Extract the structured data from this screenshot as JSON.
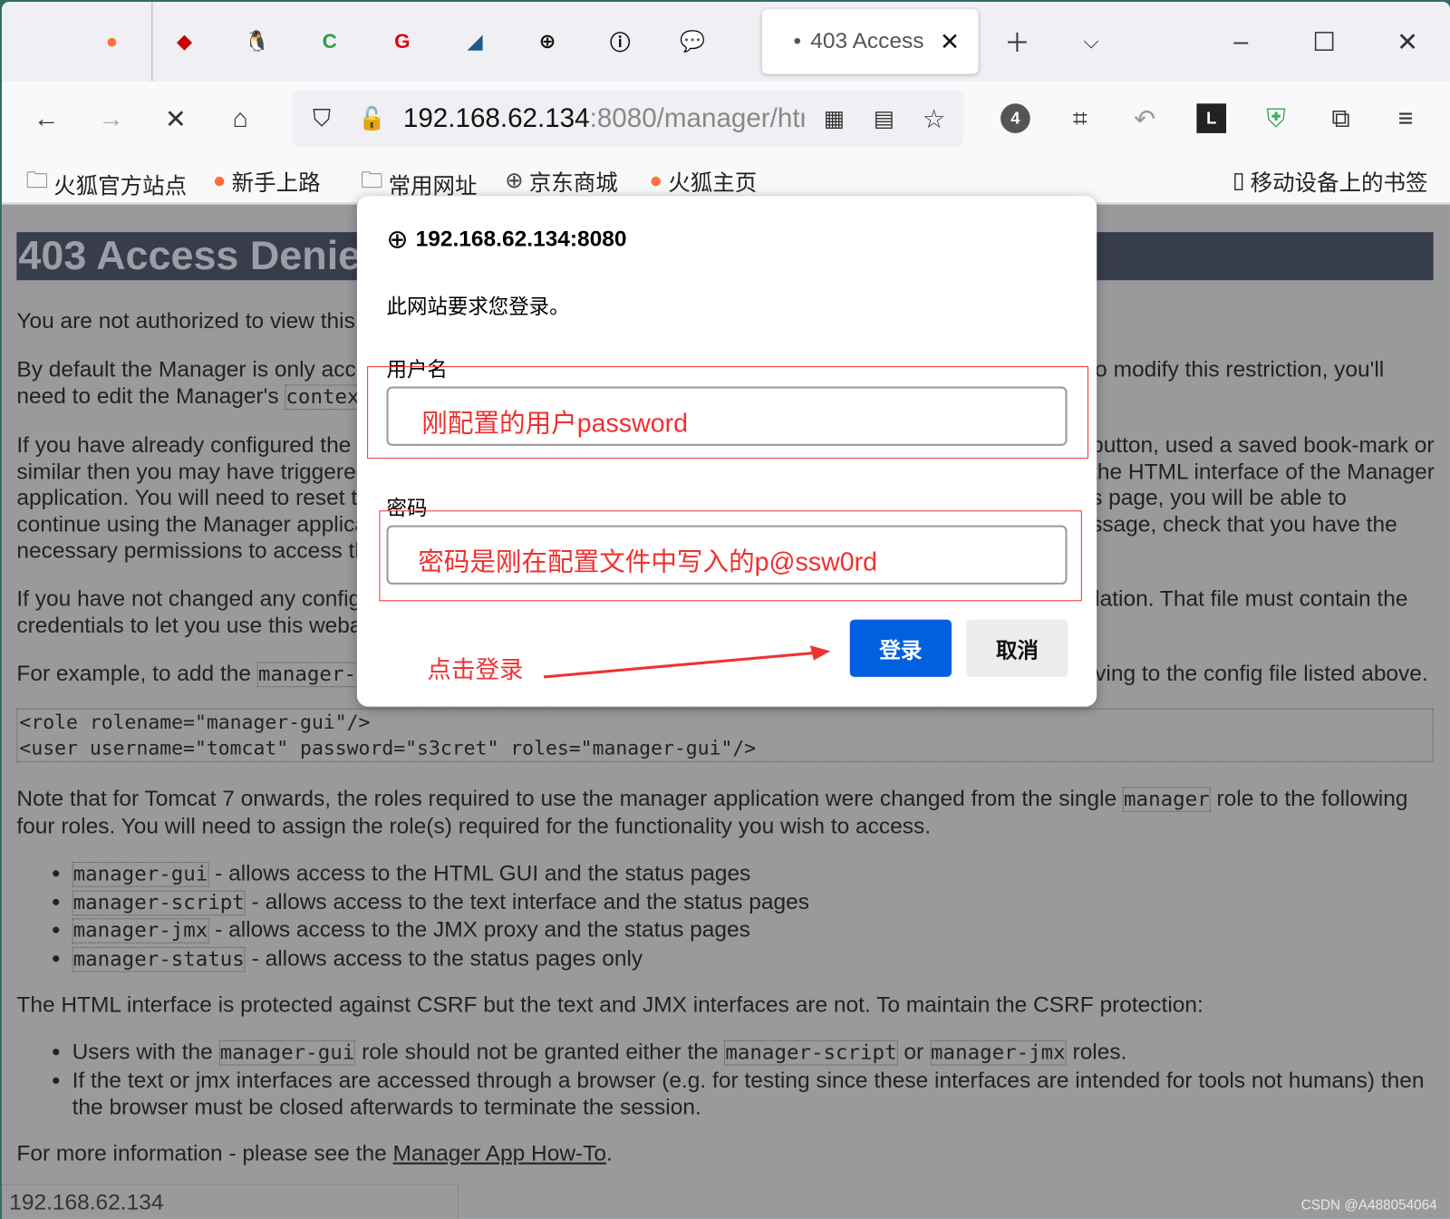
{
  "browser": {
    "pinned_tabs": [
      {
        "icon": "firefox-icon",
        "glyph": "●",
        "color": "#ff7139"
      },
      {
        "icon": "redhat-icon",
        "glyph": "◆",
        "color": "#cc0000"
      },
      {
        "icon": "linux-penguin-icon",
        "glyph": "🐧",
        "color": "#333333"
      },
      {
        "icon": "c-logo-icon",
        "glyph": "C",
        "color": "#2e9e4a"
      },
      {
        "icon": "g-logo-icon",
        "glyph": "G",
        "color": "#e00012"
      },
      {
        "icon": "mysql-icon",
        "glyph": "◢",
        "color": "#1d5a8a"
      },
      {
        "icon": "globe-icon",
        "glyph": "⊕",
        "color": "#111111"
      },
      {
        "icon": "info-icon",
        "glyph": "ⓘ",
        "color": "#111111"
      },
      {
        "icon": "chat-icon",
        "glyph": "💬",
        "color": "#1677ff"
      }
    ],
    "active_tab": {
      "title": "403 Access",
      "dot": "•"
    },
    "url_host": "192.168.62.134",
    "url_rest": ":8080/manager/htr",
    "toolbar_badge": "4",
    "bookmarks": [
      {
        "icon": "folder-icon",
        "label": "火狐官方站点"
      },
      {
        "icon": "firefox-icon",
        "label": "新手上路"
      },
      {
        "icon": "folder-icon",
        "label": "常用网址"
      },
      {
        "icon": "globe-icon",
        "label": "京东商城"
      },
      {
        "icon": "firefox-icon",
        "label": "火狐主页"
      }
    ],
    "mobile_bookmarks": "移动设备上的书签"
  },
  "page": {
    "title": "403 Access Denie",
    "p1": "You are not authorized to view this",
    "p2a": "By default the Manager is only acce",
    "p2a_r": "o modify this restriction, you'll",
    "p2b": "need to edit the Manager's ",
    "p2b_code": "contex",
    "p3": [
      "If you have already configured the",
      "similar then you may have triggerec",
      "application. You will need to reset t",
      "continue using the Manager applica",
      "necessary permissions to access thi"
    ],
    "p3_r": [
      "button, used a saved book-mark or",
      "the HTML interface of the Manager",
      "s page, you will be able to",
      "ssage, check that you have the",
      ""
    ],
    "p4": [
      "If you have not changed any config",
      "credentials to let you use this weba"
    ],
    "p4_r": "lation. That file must contain the",
    "p5": "For example, to add the ",
    "p5_code": "manager-g",
    "p5_r": "ving to the config file listed above.",
    "pre": "<role rolename=\"manager-gui\"/>\n<user username=\"tomcat\" password=\"s3cret\" roles=\"manager-gui\"/>",
    "p6a": "Note that for Tomcat 7 onwards, the roles required to use the manager application were changed from the single ",
    "p6_code": "manager",
    "p6b": " role to the following",
    "p6c": "four roles. You will need to assign the role(s) required for the functionality you wish to access.",
    "roles": [
      {
        "code": "manager-gui",
        "text": " - allows access to the HTML GUI and the status pages"
      },
      {
        "code": "manager-script",
        "text": " - allows access to the text interface and the status pages"
      },
      {
        "code": "manager-jmx",
        "text": " - allows access to the JMX proxy and the status pages"
      },
      {
        "code": "manager-status",
        "text": " - allows access to the status pages only"
      }
    ],
    "p7": "The HTML interface is protected against CSRF but the text and JMX interfaces are not. To maintain the CSRF protection:",
    "csrf1": {
      "a": "Users with the ",
      "c1": "manager-gui",
      "b": " role should not be granted either the ",
      "c2": "manager-script",
      "c": " or ",
      "c3": "manager-jmx",
      "d": " roles."
    },
    "csrf2": [
      "If the text or jmx interfaces are accessed through a browser (e.g. for testing since these interfaces are intended for tools not humans) then",
      "the browser must be closed afterwards to terminate the session."
    ],
    "p8a": "For more information - please see the ",
    "p8_link": "Manager App How-To",
    "p8b": "."
  },
  "status_bar": "192.168.62.134",
  "watermark": "CSDN @A488054064",
  "dialog": {
    "host": "192.168.62.134:8080",
    "message": "此网站要求您登录。",
    "username_label": "用户名",
    "username_value": "刚配置的用户password",
    "password_label": "密码",
    "password_value": "密码是刚在配置文件中写入的p@ssw0rd",
    "login": "登录",
    "cancel": "取消",
    "annotation": "点击登录"
  },
  "colors": {
    "primary": "#0060df",
    "annotation": "#ee3333"
  }
}
